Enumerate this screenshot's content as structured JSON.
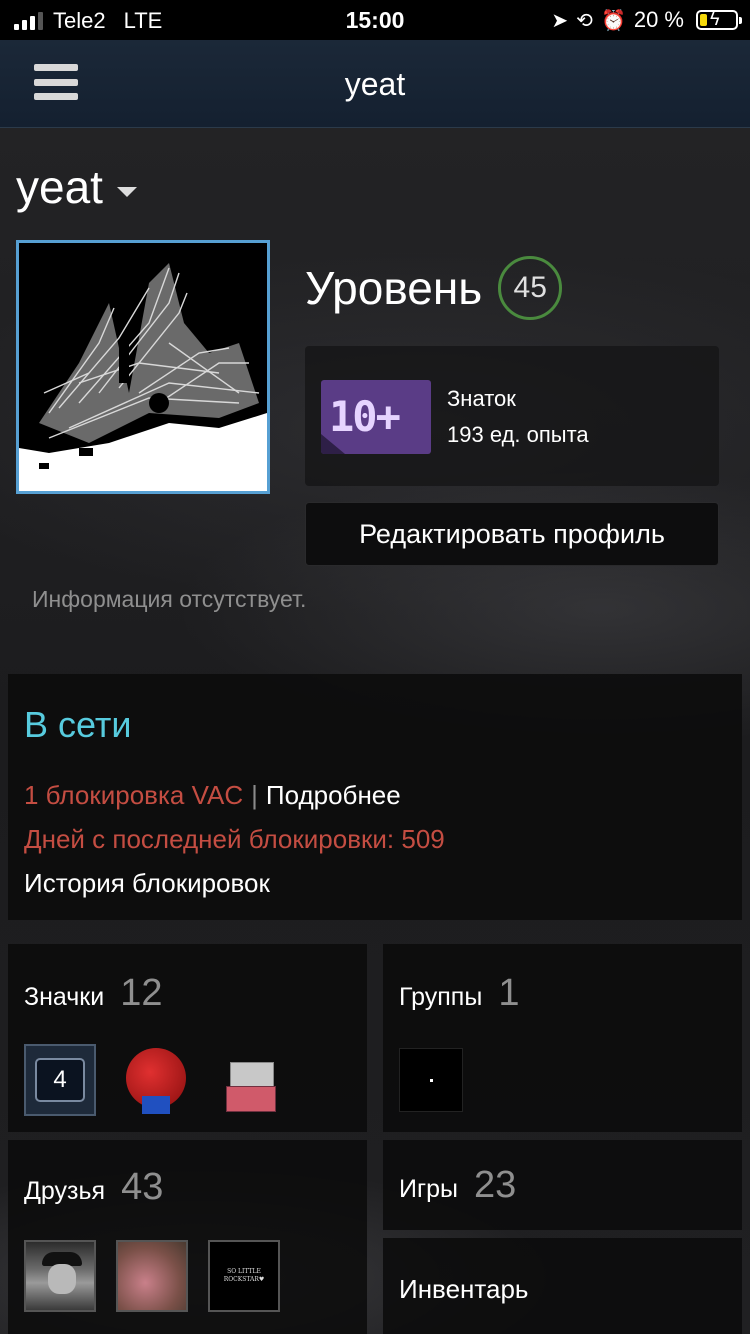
{
  "status_bar": {
    "carrier": "Tele2",
    "network": "LTE",
    "time": "15:00",
    "battery_percent": "20 %",
    "battery_level": 0.2,
    "icons": [
      "location-arrow-icon",
      "orientation-lock-icon",
      "alarm-icon",
      "charging-bolt-icon"
    ]
  },
  "header": {
    "title": "yeat",
    "menu_icon": "hamburger-menu-icon"
  },
  "profile": {
    "name": "yeat",
    "level_label": "Уровень",
    "level": "45",
    "badge": {
      "image_text": "10+",
      "title": "Знаток",
      "xp": "193 ед. опыта"
    },
    "edit_button": "Редактировать профиль",
    "summary": "Информация отсутствует."
  },
  "status": {
    "online": "В сети",
    "vac_bans": "1 блокировка VAC",
    "separator": "|",
    "details_link": "Подробнее",
    "days_since_ban": "Дней с последней блокировки: 509",
    "ban_history": "История блокировок",
    "colors": {
      "online": "#57cbde",
      "ban": "#c44d42"
    }
  },
  "tiles": {
    "badges": {
      "label": "Значки",
      "count": "12",
      "first_badge_text": "4"
    },
    "groups": {
      "label": "Группы",
      "count": "1"
    },
    "friends": {
      "label": "Друзья",
      "count": "43",
      "third_avatar_text": "SO LITTLE ROCKSTAR♥"
    },
    "games": {
      "label": "Игры",
      "count": "23"
    },
    "inventory": {
      "label": "Инвентарь"
    }
  }
}
